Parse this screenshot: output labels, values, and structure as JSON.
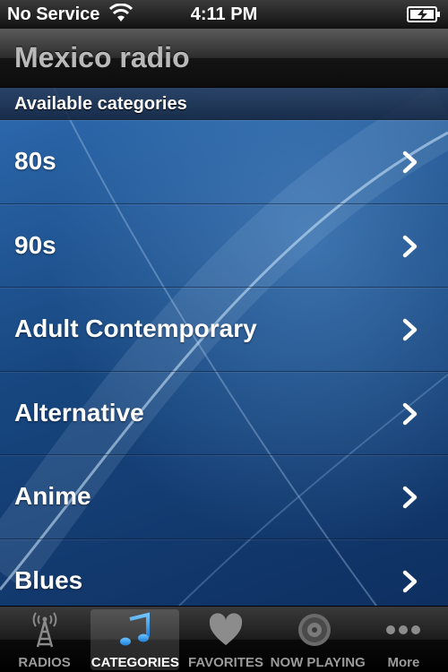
{
  "status_bar": {
    "carrier": "No Service",
    "time": "4:11 PM"
  },
  "nav_bar": {
    "title": "Mexico radio"
  },
  "section": {
    "title": "Available categories"
  },
  "categories": [
    {
      "label": "80s"
    },
    {
      "label": "90s"
    },
    {
      "label": "Adult Contemporary"
    },
    {
      "label": "Alternative"
    },
    {
      "label": "Anime"
    },
    {
      "label": "Blues"
    }
  ],
  "tab_bar": {
    "tabs": [
      {
        "label": "RADIOS",
        "icon": "radio-tower-icon",
        "active": false
      },
      {
        "label": "CATEGORIES",
        "icon": "music-note-icon",
        "active": true
      },
      {
        "label": "FAVORITES",
        "icon": "heart-icon",
        "active": false
      },
      {
        "label": "NOW PLAYING",
        "icon": "speaker-icon",
        "active": false
      },
      {
        "label": "More",
        "icon": "more-dots-icon",
        "active": false
      }
    ]
  },
  "colors": {
    "accent_blue": "#2e8fe0",
    "list_background": "#17467f",
    "nav_title": "#b9b9b9"
  }
}
